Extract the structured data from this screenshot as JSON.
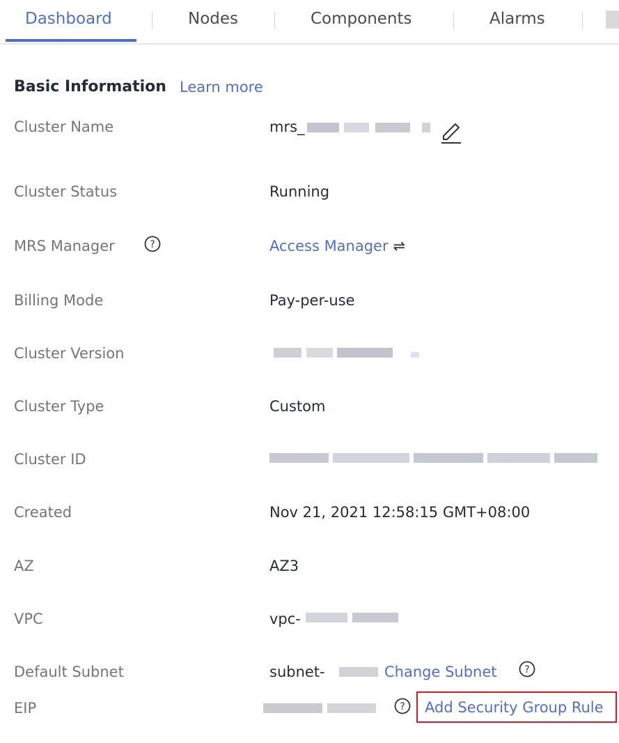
{
  "tabs": [
    {
      "label": "Dashboard",
      "active": true
    },
    {
      "label": "Nodes"
    },
    {
      "label": "Components"
    },
    {
      "label": "Alarms"
    }
  ],
  "section": {
    "title": "Basic Information",
    "learn_more": "Learn more"
  },
  "rows": {
    "cluster_name": {
      "label": "Cluster Name",
      "value_prefix": "mrs_"
    },
    "cluster_status": {
      "label": "Cluster Status",
      "value": "Running"
    },
    "mrs_manager": {
      "label": "MRS Manager",
      "link": "Access Manager",
      "link_icon": "⇌"
    },
    "billing_mode": {
      "label": "Billing Mode",
      "value": "Pay-per-use"
    },
    "cluster_version": {
      "label": "Cluster Version"
    },
    "cluster_type": {
      "label": "Cluster Type",
      "value": "Custom"
    },
    "cluster_id": {
      "label": "Cluster ID"
    },
    "created": {
      "label": "Created",
      "value": "Nov 21, 2021 12:58:15 GMT+08:00"
    },
    "az": {
      "label": "AZ",
      "value": "AZ3"
    },
    "vpc": {
      "label": "VPC",
      "value_prefix": "vpc-"
    },
    "default_subnet": {
      "label": "Default Subnet",
      "value_prefix": "subnet-",
      "link": "Change Subnet"
    },
    "eip": {
      "label": "EIP",
      "link": "Add Security Group Rule"
    }
  },
  "icons": {
    "help": "question-circle-icon",
    "edit": "pencil-icon"
  },
  "colors": {
    "accent": "#526ecc",
    "highlight_border": "#e0162a",
    "label": "#757575",
    "text": "#252b3a"
  }
}
